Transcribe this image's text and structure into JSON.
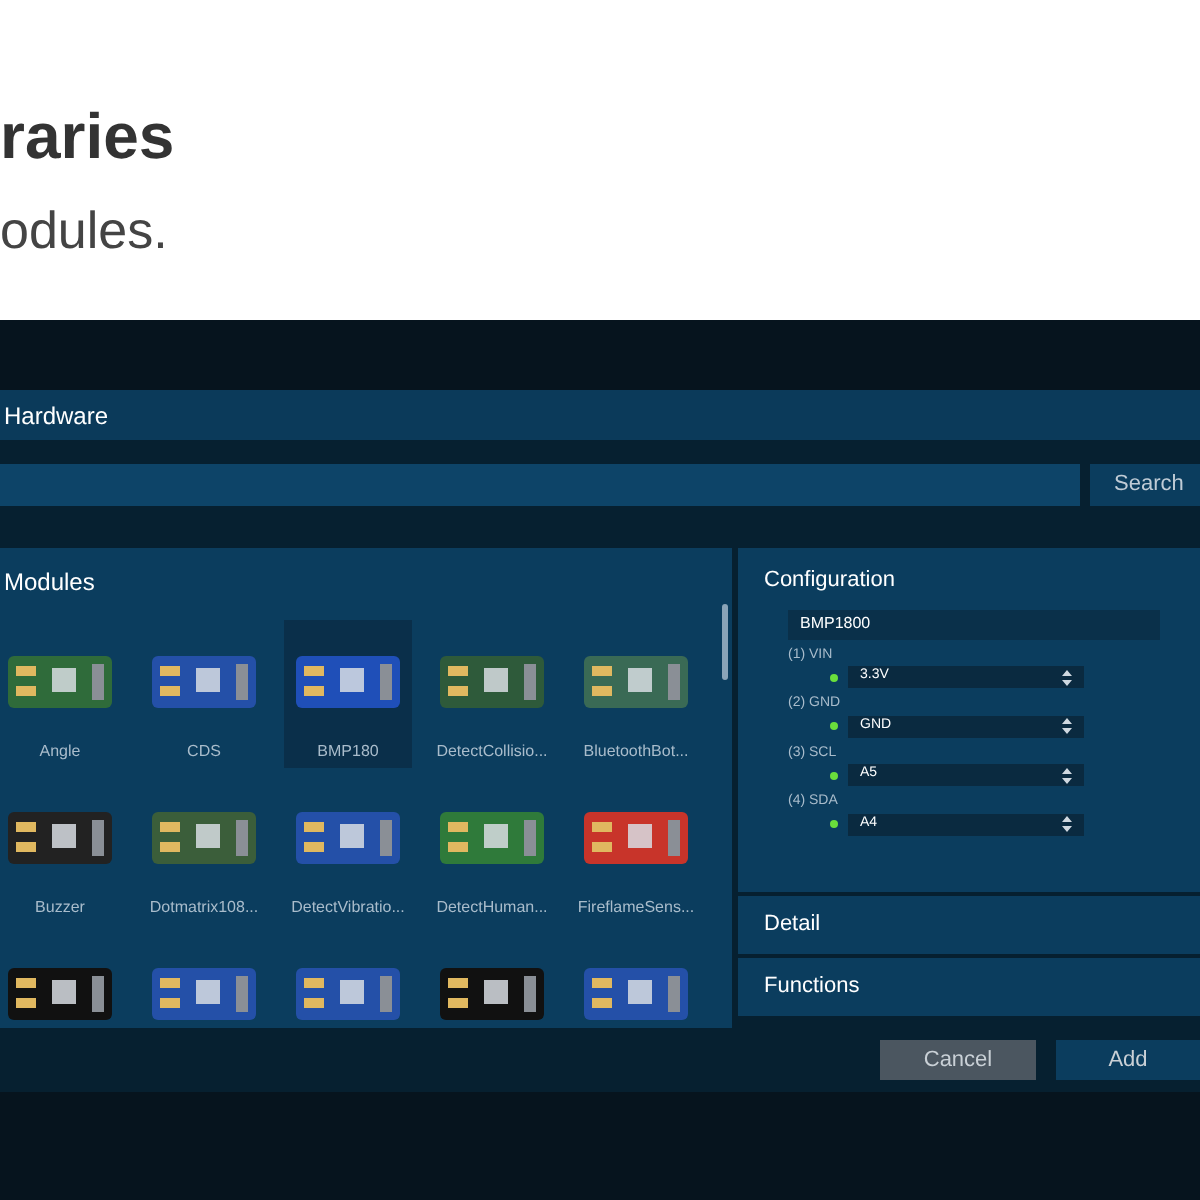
{
  "heading": {
    "title": "raries",
    "subtitle": "odules."
  },
  "dialog": {
    "title": "Hardware",
    "search_button": "Search",
    "modules_title": "Modules",
    "modules": [
      {
        "label": "Angle",
        "selected": false,
        "color": "#2f6b3a"
      },
      {
        "label": "CDS",
        "selected": false,
        "color": "#2450a8"
      },
      {
        "label": "BMP180",
        "selected": true,
        "color": "#1f4fb8"
      },
      {
        "label": "DetectCollisio...",
        "selected": false,
        "color": "#2e5a3a"
      },
      {
        "label": "BluetoothBot...",
        "selected": false,
        "color": "#3a6a55"
      },
      {
        "label": "Buzzer",
        "selected": false,
        "color": "#222222"
      },
      {
        "label": "Dotmatrix108...",
        "selected": false,
        "color": "#3b5e3a"
      },
      {
        "label": "DetectVibratio...",
        "selected": false,
        "color": "#2450a8"
      },
      {
        "label": "DetectHuman...",
        "selected": false,
        "color": "#2f7a3a"
      },
      {
        "label": "FireflameSens...",
        "selected": false,
        "color": "#c8342a"
      },
      {
        "selected": false,
        "color": "#111111"
      },
      {
        "selected": false,
        "color": "#2450a8"
      },
      {
        "selected": false,
        "color": "#2450a8"
      },
      {
        "selected": false,
        "color": "#111111"
      },
      {
        "selected": false,
        "color": "#2450a8"
      }
    ],
    "configuration": {
      "title": "Configuration",
      "name": "BMP1800",
      "pins": [
        {
          "label": "(1) VIN",
          "value": "3.3V",
          "connected": true
        },
        {
          "label": "(2) GND",
          "value": "GND",
          "connected": true
        },
        {
          "label": "(3) SCL",
          "value": "A5",
          "connected": true
        },
        {
          "label": "(4) SDA",
          "value": "A4",
          "connected": true
        }
      ]
    },
    "sections": [
      "Detail",
      "Functions"
    ],
    "buttons": {
      "cancel": "Cancel",
      "add": "Add"
    }
  }
}
